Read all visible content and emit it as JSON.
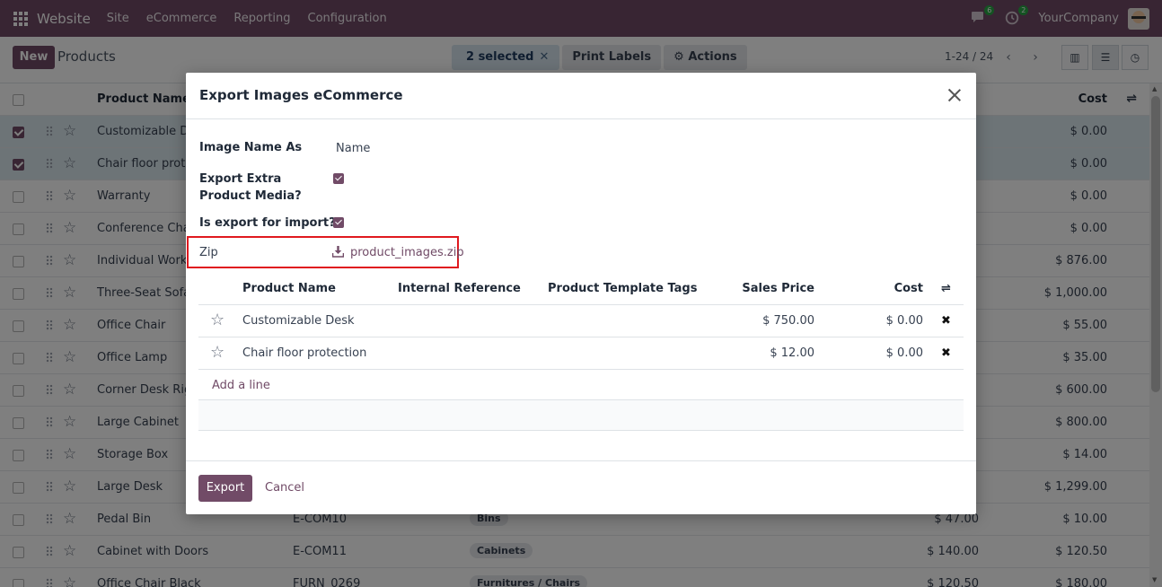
{
  "navbar": {
    "brand": "Website",
    "menu": [
      "Site",
      "eCommerce",
      "Reporting",
      "Configuration"
    ],
    "messages_count": "6",
    "activities_count": "2",
    "company": "YourCompany"
  },
  "control_panel": {
    "new_label": "New",
    "title": "Products",
    "selected_label": "2 selected",
    "print_labels": "Print Labels",
    "actions": "Actions",
    "pager": "1-24 / 24"
  },
  "list": {
    "headers": {
      "name": "Product Name",
      "cost": "Cost"
    },
    "rows": [
      {
        "name": "Customizable Desk",
        "ref": "",
        "tag": "",
        "price": "",
        "cost": "$ 0.00",
        "checked": true
      },
      {
        "name": "Chair floor protection",
        "ref": "",
        "tag": "",
        "price": "",
        "cost": "$ 0.00",
        "checked": true
      },
      {
        "name": "Warranty",
        "ref": "",
        "tag": "",
        "price": "",
        "cost": "$ 0.00",
        "checked": false
      },
      {
        "name": "Conference Chair",
        "ref": "",
        "tag": "",
        "price": "",
        "cost": "$ 0.00",
        "checked": false
      },
      {
        "name": "Individual Workplace",
        "ref": "",
        "tag": "",
        "price": "",
        "cost": "$ 876.00",
        "checked": false
      },
      {
        "name": "Three-Seat Sofa",
        "ref": "",
        "tag": "",
        "price": "",
        "cost": "$ 1,000.00",
        "checked": false
      },
      {
        "name": "Office Chair",
        "ref": "",
        "tag": "",
        "price": "",
        "cost": "$ 55.00",
        "checked": false
      },
      {
        "name": "Office Lamp",
        "ref": "",
        "tag": "",
        "price": "",
        "cost": "$ 35.00",
        "checked": false
      },
      {
        "name": "Corner Desk Right Sit",
        "ref": "",
        "tag": "",
        "price": "",
        "cost": "$ 600.00",
        "checked": false
      },
      {
        "name": "Large Cabinet",
        "ref": "",
        "tag": "",
        "price": "",
        "cost": "$ 800.00",
        "checked": false
      },
      {
        "name": "Storage Box",
        "ref": "",
        "tag": "",
        "price": "",
        "cost": "$ 14.00",
        "checked": false
      },
      {
        "name": "Large Desk",
        "ref": "",
        "tag": "",
        "price": "",
        "cost": "$ 1,299.00",
        "checked": false
      },
      {
        "name": "Pedal Bin",
        "ref": "E-COM10",
        "tag": "Bins",
        "price": "$ 47.00",
        "cost": "$ 10.00",
        "checked": false
      },
      {
        "name": "Cabinet with Doors",
        "ref": "E-COM11",
        "tag": "Cabinets",
        "price": "$ 140.00",
        "cost": "$ 120.50",
        "checked": false
      },
      {
        "name": "Office Chair Black",
        "ref": "FURN_0269",
        "tag": "Furnitures / Chairs",
        "price": "$ 120.50",
        "cost": "$ 180.00",
        "checked": false
      }
    ]
  },
  "modal": {
    "title": "Export Images eCommerce",
    "fields": {
      "image_name_as_label": "Image Name As",
      "image_name_as_value": "Name",
      "extra_media_label": "Export Extra Product Media?",
      "extra_media_checked": true,
      "for_import_label": "Is export for import?",
      "for_import_checked": true,
      "zip_label": "Zip",
      "zip_file": "product_images.zip"
    },
    "table": {
      "headers": {
        "name": "Product Name",
        "ref": "Internal Reference",
        "tags": "Product Template Tags",
        "price": "Sales Price",
        "cost": "Cost"
      },
      "rows": [
        {
          "name": "Customizable Desk",
          "price": "$ 750.00",
          "cost": "$ 0.00"
        },
        {
          "name": "Chair floor protection",
          "price": "$ 12.00",
          "cost": "$ 0.00"
        }
      ],
      "add_line": "Add a line"
    },
    "export_label": "Export",
    "cancel_label": "Cancel"
  },
  "colors": {
    "brand": "#714b67",
    "highlight_box": "#e0191f",
    "selected_row": "#dbe8ee"
  }
}
